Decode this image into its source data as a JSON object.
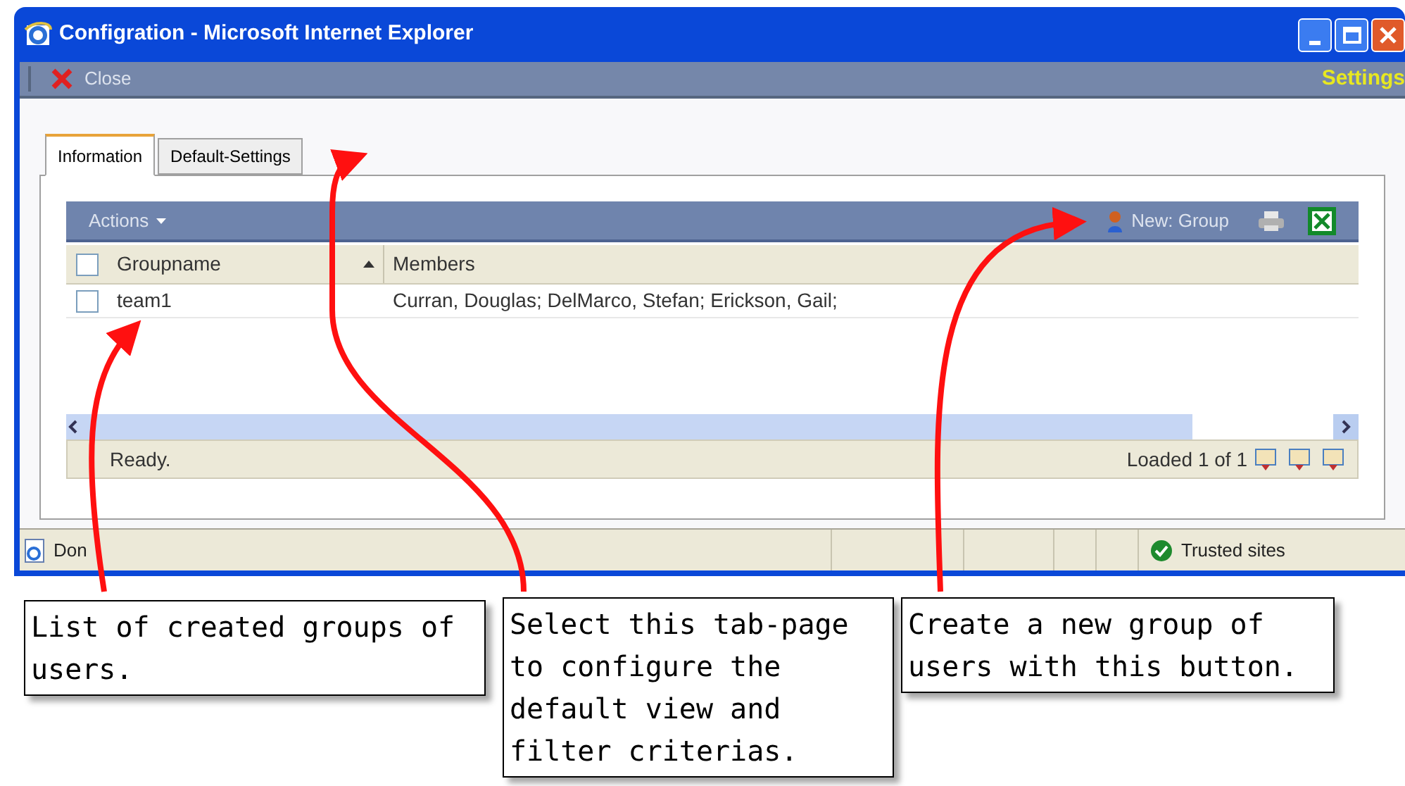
{
  "window": {
    "title": "Configration - Microsoft Internet Explorer"
  },
  "toolbar": {
    "close_label": "Close",
    "page_title": "Settings"
  },
  "tabs": [
    {
      "label": "Information",
      "selected": true
    },
    {
      "label": "Default-Settings",
      "selected": false
    }
  ],
  "grid": {
    "actions_label": "Actions",
    "new_label": "New: Group",
    "all_checked": false,
    "columns": [
      {
        "label": "Groupname",
        "sorted": true
      },
      {
        "label": "Members",
        "sorted": false
      }
    ],
    "rows": [
      {
        "checked": false,
        "cells": [
          "team1",
          "Curran, Douglas; DelMarco, Stefan; Erickson, Gail;"
        ]
      }
    ],
    "status": "Ready.",
    "loaded": "Loaded 1 of 1"
  },
  "browser_status": {
    "text": "Don",
    "zone": "Trusted sites"
  },
  "callouts": [
    {
      "text": "List of created groups of users."
    },
    {
      "text": "Select this tab-page to configure the default view and filter criterias."
    },
    {
      "text": "Create a new group of users with this button."
    }
  ]
}
